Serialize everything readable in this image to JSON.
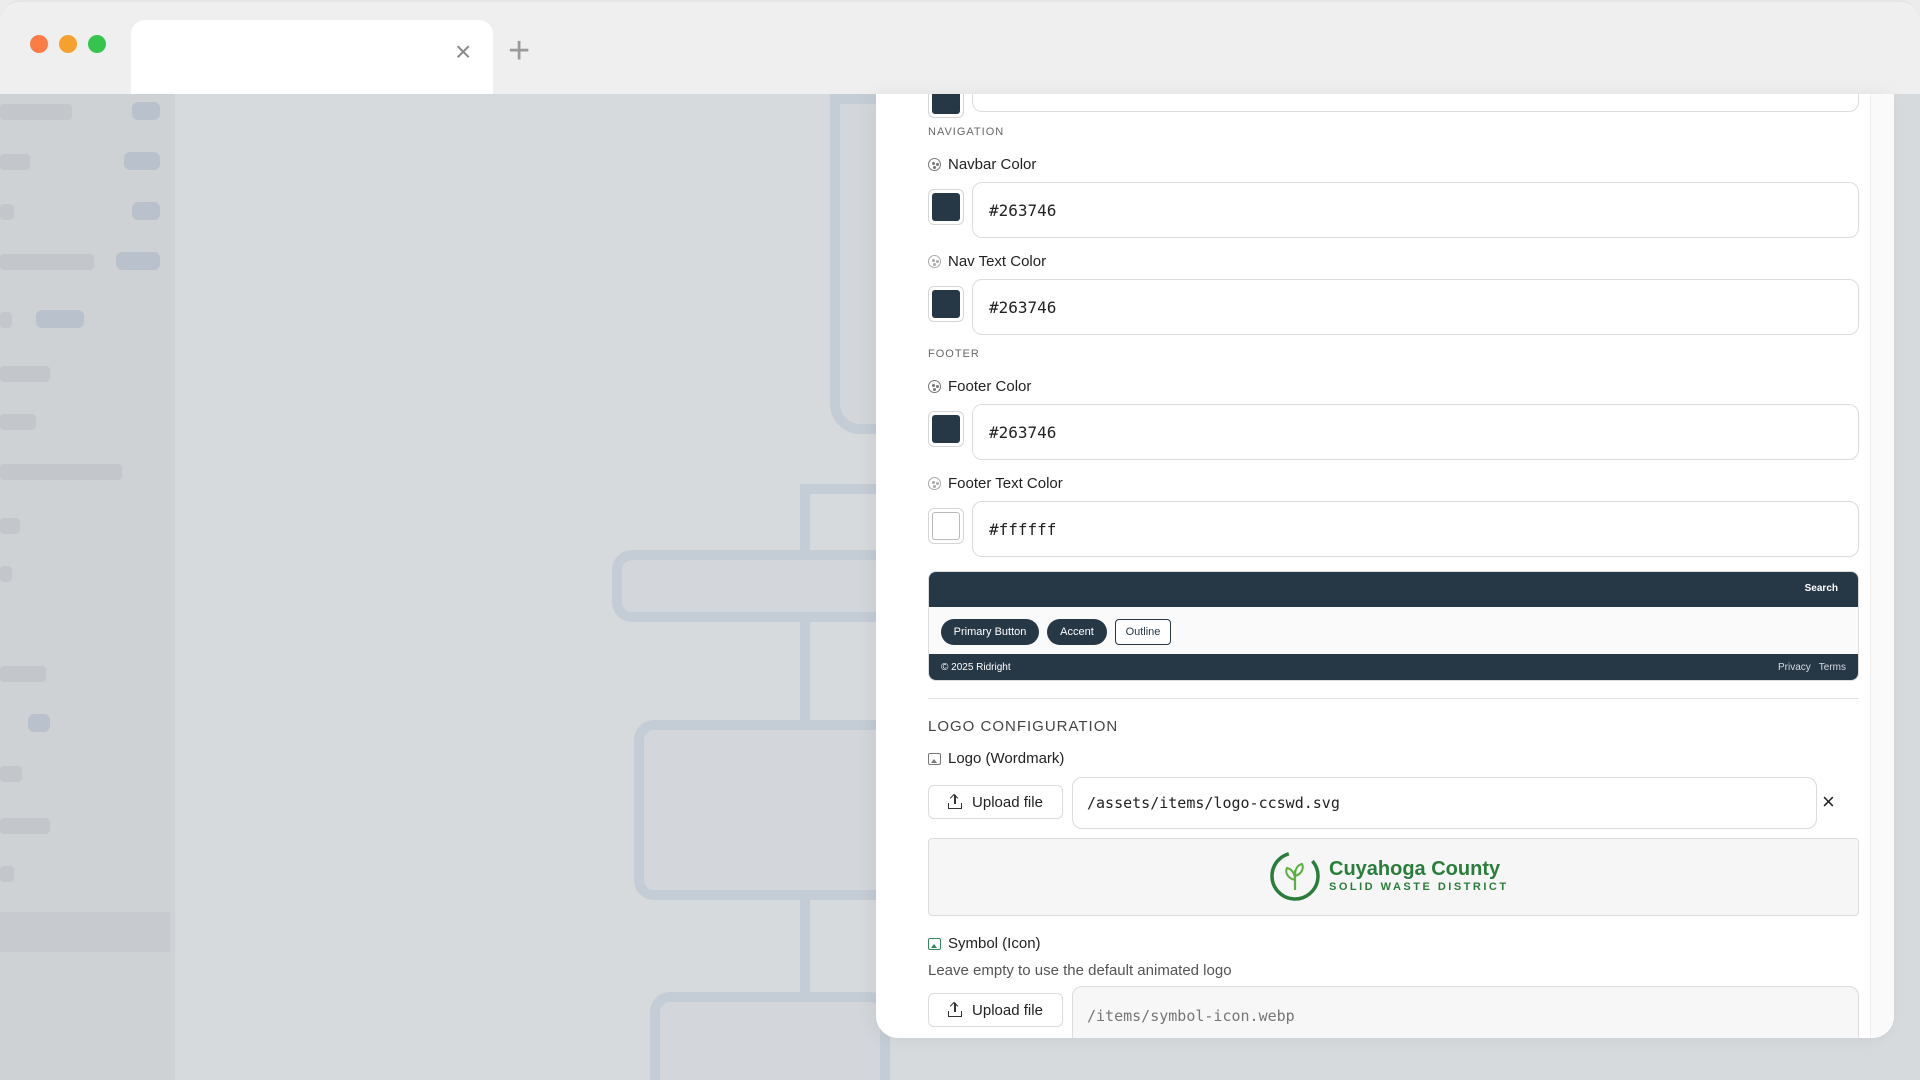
{
  "browser": {
    "close_tab_glyph": "×",
    "new_tab_glyph": "+"
  },
  "panel": {
    "navigation": {
      "section_label": "NAVIGATION",
      "navbar_color": {
        "label": "Navbar Color",
        "value": "#263746",
        "swatch": "#263746"
      },
      "nav_text_color": {
        "label": "Nav Text Color",
        "value": "#263746",
        "swatch": "#263746"
      }
    },
    "footer": {
      "section_label": "FOOTER",
      "footer_color": {
        "label": "Footer Color",
        "value": "#263746",
        "swatch": "#263746"
      },
      "footer_text_color": {
        "label": "Footer Text Color",
        "value": "#ffffff",
        "swatch": "#ffffff"
      }
    },
    "preview": {
      "nav_search": "Search",
      "primary_button": "Primary Button",
      "accent_button": "Accent",
      "outline_button": "Outline",
      "footer_copy": "© 2025 Ridright",
      "footer_links": [
        "Privacy",
        "Terms"
      ]
    },
    "logo_config": {
      "title": "LOGO CONFIGURATION",
      "wordmark_label": "Logo (Wordmark)",
      "upload_label": "Upload file",
      "wordmark_path": "/assets/items/logo-ccswd.svg",
      "clear_glyph": "×",
      "logo_name": "Cuyahoga County",
      "logo_sub": "SOLID WASTE DISTRICT",
      "symbol_label": "Symbol (Icon)",
      "symbol_helper": "Leave empty to use the default animated logo",
      "symbol_upload_label": "Upload file",
      "symbol_placeholder": "/items/symbol-icon.webp"
    }
  },
  "colors": {
    "navy": "#263746",
    "brand_green": "#2a7d3b"
  }
}
